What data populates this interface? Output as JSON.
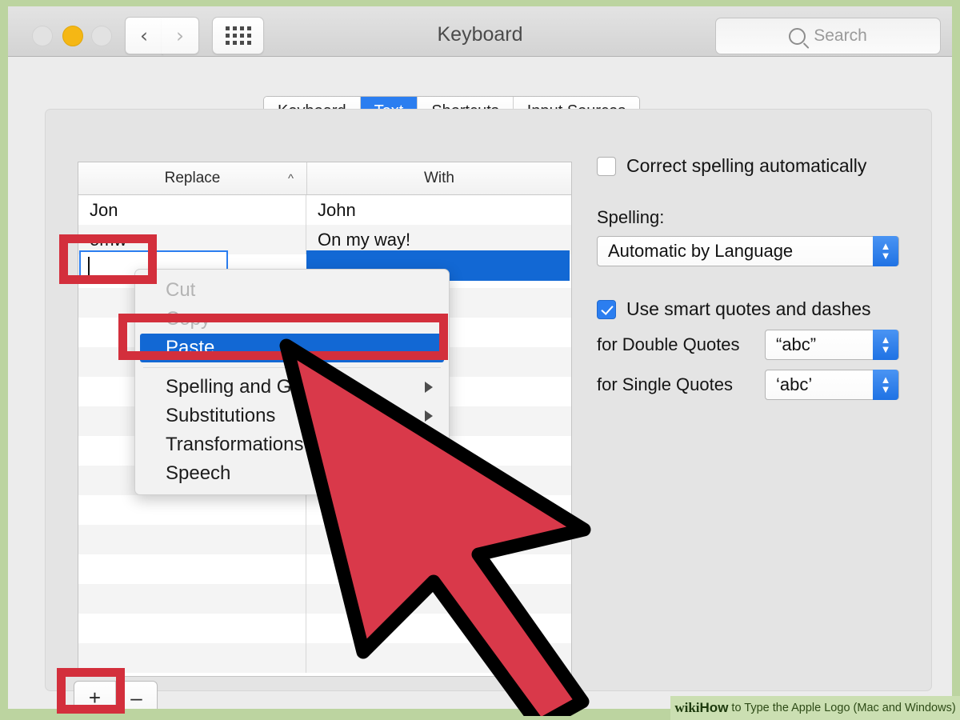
{
  "window": {
    "title": "Keyboard",
    "traffic_lights": [
      "close",
      "minimize",
      "zoom"
    ],
    "back_icon": "chevron-left-icon",
    "forward_icon": "chevron-right-icon",
    "grid_icon": "show-all-grid-icon",
    "search": {
      "placeholder": "Search",
      "icon": "search-icon",
      "value": ""
    }
  },
  "tabs": [
    {
      "label": "Keyboard",
      "active": false
    },
    {
      "label": "Text",
      "active": true
    },
    {
      "label": "Shortcuts",
      "active": false
    },
    {
      "label": "Input Sources",
      "active": false
    }
  ],
  "table": {
    "columns": [
      "Replace",
      "With"
    ],
    "sort_indicator": "^",
    "rows": [
      {
        "replace": "Jon",
        "with": "John"
      },
      {
        "replace": "omw",
        "with": "On my way!"
      }
    ],
    "new_row": {
      "replace_value": "",
      "with_value": "",
      "editing": true,
      "selected": true
    }
  },
  "footer_buttons": {
    "add": "+",
    "remove": "–"
  },
  "options": {
    "correct_spelling": {
      "label": "Correct spelling automatically",
      "checked": false
    },
    "spelling_label": "Spelling:",
    "spelling_value": "Automatic by Language",
    "smart_quotes": {
      "label": "Use smart quotes and dashes",
      "checked": true
    },
    "double_quotes_label": "for Double Quotes",
    "double_quotes_value": "“abc”",
    "single_quotes_label": "for Single Quotes",
    "single_quotes_value": "‘abc’"
  },
  "context_menu": {
    "items": [
      {
        "label": "Cut",
        "state": "disabled",
        "submenu": false
      },
      {
        "label": "Copy",
        "state": "disabled",
        "submenu": false
      },
      {
        "label": "Paste",
        "state": "highlighted",
        "submenu": false
      },
      {
        "label": "Spelling and Grammar",
        "state": "normal",
        "submenu": true
      },
      {
        "label": "Substitutions",
        "state": "normal",
        "submenu": true
      },
      {
        "label": "Transformations",
        "state": "normal",
        "submenu": true
      },
      {
        "label": "Speech",
        "state": "normal",
        "submenu": true
      }
    ]
  },
  "annotations": {
    "highlight_color": "#d32f3c",
    "cursor_color": "#d9394a",
    "accent_blue": "#2b7ef0",
    "selection_blue": "#1268d4",
    "frame_green": "#bcd4a0"
  },
  "watermark": {
    "wiki": "wiki",
    "how": "How",
    "rest": "to Type the Apple Logo (Mac and Windows)"
  }
}
